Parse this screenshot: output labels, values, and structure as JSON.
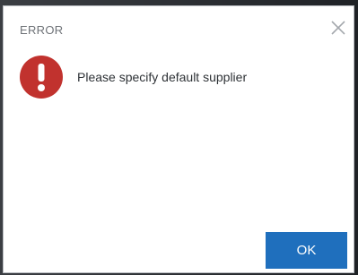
{
  "dialog": {
    "title": "ERROR",
    "message": "Please specify default supplier",
    "ok_label": "OK",
    "icon": "error-exclamation-icon",
    "close_icon": "close-icon"
  },
  "colors": {
    "error_red": "#c1322e",
    "accent_blue": "#1f6fbd",
    "title_gray": "#6f7378"
  }
}
